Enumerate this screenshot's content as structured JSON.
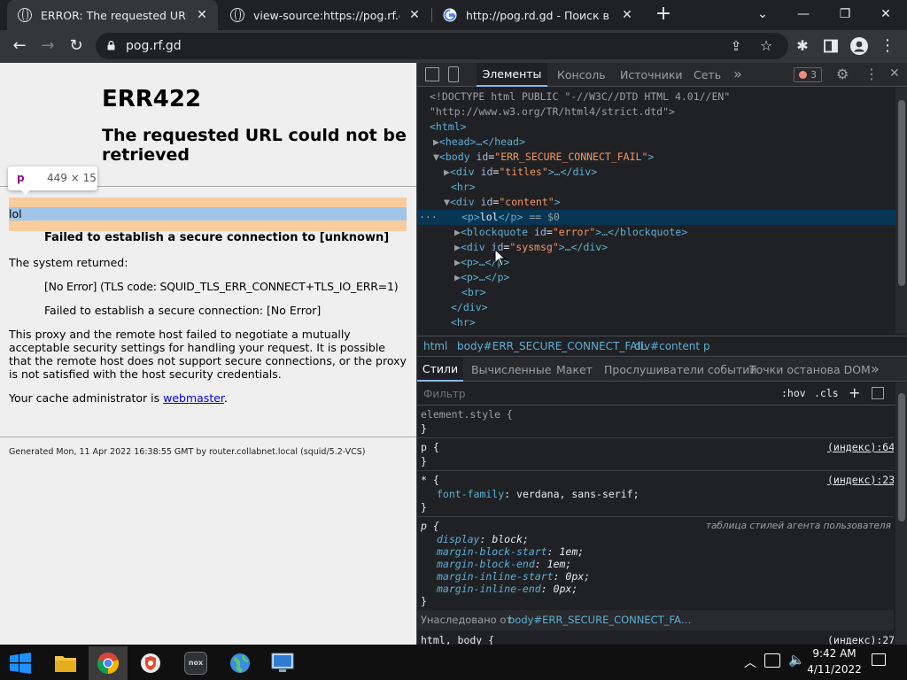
{
  "tabs": [
    {
      "title": "ERROR: The requested URL could not be retrieved",
      "icon": "globe-icon"
    },
    {
      "title": "view-source:https://pog.rf.gd",
      "icon": "globe-icon"
    },
    {
      "title": "http://pog.rd.gd - Поиск в Google",
      "icon": "google-icon"
    }
  ],
  "new_tab": "+",
  "url": "pog.rf.gd",
  "page": {
    "h1": "ERR422",
    "h2": "The requested URL could not be retrieved",
    "tooltip_tag": "p",
    "tooltip_size": "449 × 15",
    "lol": "lol",
    "blockquote": "Failed to establish a secure connection to [unknown]",
    "system_returned": "The system returned:",
    "sys1": "[No Error] (TLS code: SQUID_TLS_ERR_CONNECT+TLS_IO_ERR=1)",
    "sys2": "Failed to establish a secure connection: [No Error]",
    "para": "This proxy and the remote host failed to negotiate a mutually acceptable security settings for handling your request. It is possible that the remote host does not support secure connections, or the proxy is not satisfied with the host security credentials.",
    "cache_prefix": "Your cache administrator is ",
    "cache_link": "webmaster",
    "cache_suffix": ".",
    "footer": "Generated Mon, 11 Apr 2022 16:38:55 GMT by router.collabnet.local (squid/5.2-VCS)"
  },
  "devtools": {
    "tabs": [
      "Элементы",
      "Консоль",
      "Источники",
      "Сеть"
    ],
    "more": "»",
    "error_count": "3",
    "breadcrumb": [
      "html",
      "body#ERR_SECURE_CONNECT_FAIL",
      "div#content",
      "p"
    ],
    "style_tabs": [
      "Стили",
      "Вычисленные",
      "Макет",
      "Прослушиватели событий",
      "Точки останова DOM"
    ],
    "filter_placeholder": "Фильтр",
    "hov": ":hov",
    "cls": ".cls",
    "plus": "+",
    "dom": {
      "doctype1": "<!DOCTYPE html PUBLIC \"-//W3C//DTD HTML 4.01//EN\"",
      "doctype2": "\"http://www.w3.org/TR/html4/strict.dtd\">",
      "html_open": "<html>",
      "head": "<head>…</head>",
      "body_open_tag": "<body ",
      "body_attr": "id",
      "body_val": "\"ERR_SECURE_CONNECT_FAIL\"",
      "gt": ">",
      "titles_tag": "<div ",
      "titles_attr": "id",
      "titles_val": "\"titles\"",
      "titles_end": ">…</div>",
      "hr": "<hr>",
      "content_tag": "<div ",
      "content_attr": "id",
      "content_val": "\"content\"",
      "p_open": "<p>",
      "p_text": "lol",
      "p_close": "</p>",
      "p_eq": " == $0",
      "bq_tag": "<blockquote ",
      "bq_attr": "id",
      "bq_val": "\"error\"",
      "bq_end": ">…</blockquote>",
      "sys_tag": "<div ",
      "sys_attr": "id",
      "sys_val": "\"sysmsg\"",
      "sys_end": ">…</div>",
      "pc1": "<p>…</p>",
      "pc2": "<p>…</p>",
      "br": "<br>",
      "div_close": "</div>",
      "hr2": "<hr>"
    },
    "styles": {
      "element_style": "element.style {",
      "close": "}",
      "p_sel": "p {",
      "p_src": "(индекс):64",
      "star_sel": "* {",
      "star_src": "(индекс):23",
      "font_prop": "font-family",
      "font_val": "verdana, sans-serif;",
      "ua_sel": "p {",
      "ua_src": "таблица стилей агента пользователя",
      "ua_props": [
        {
          "prop": "display",
          "val": "block;"
        },
        {
          "prop": "margin-block-start",
          "val": "1em;"
        },
        {
          "prop": "margin-block-end",
          "val": "1em;"
        },
        {
          "prop": "margin-inline-start",
          "val": "0px;"
        },
        {
          "prop": "margin-inline-end",
          "val": "0px;"
        }
      ],
      "inherited_label": "Унаследовано от ",
      "inherited_from": "body#ERR_SECURE_CONNECT_FA…",
      "html_body_sel": "html, body {",
      "html_body_src": "(индекс):27"
    }
  },
  "taskbar": {
    "time": "9:42 AM",
    "date": "4/11/2022"
  },
  "colors": {
    "tab_bg": "#202124",
    "toolbar_bg": "#35363a",
    "devtools_bg": "#202124",
    "selected_row": "#073655",
    "link": "#0000ee"
  }
}
